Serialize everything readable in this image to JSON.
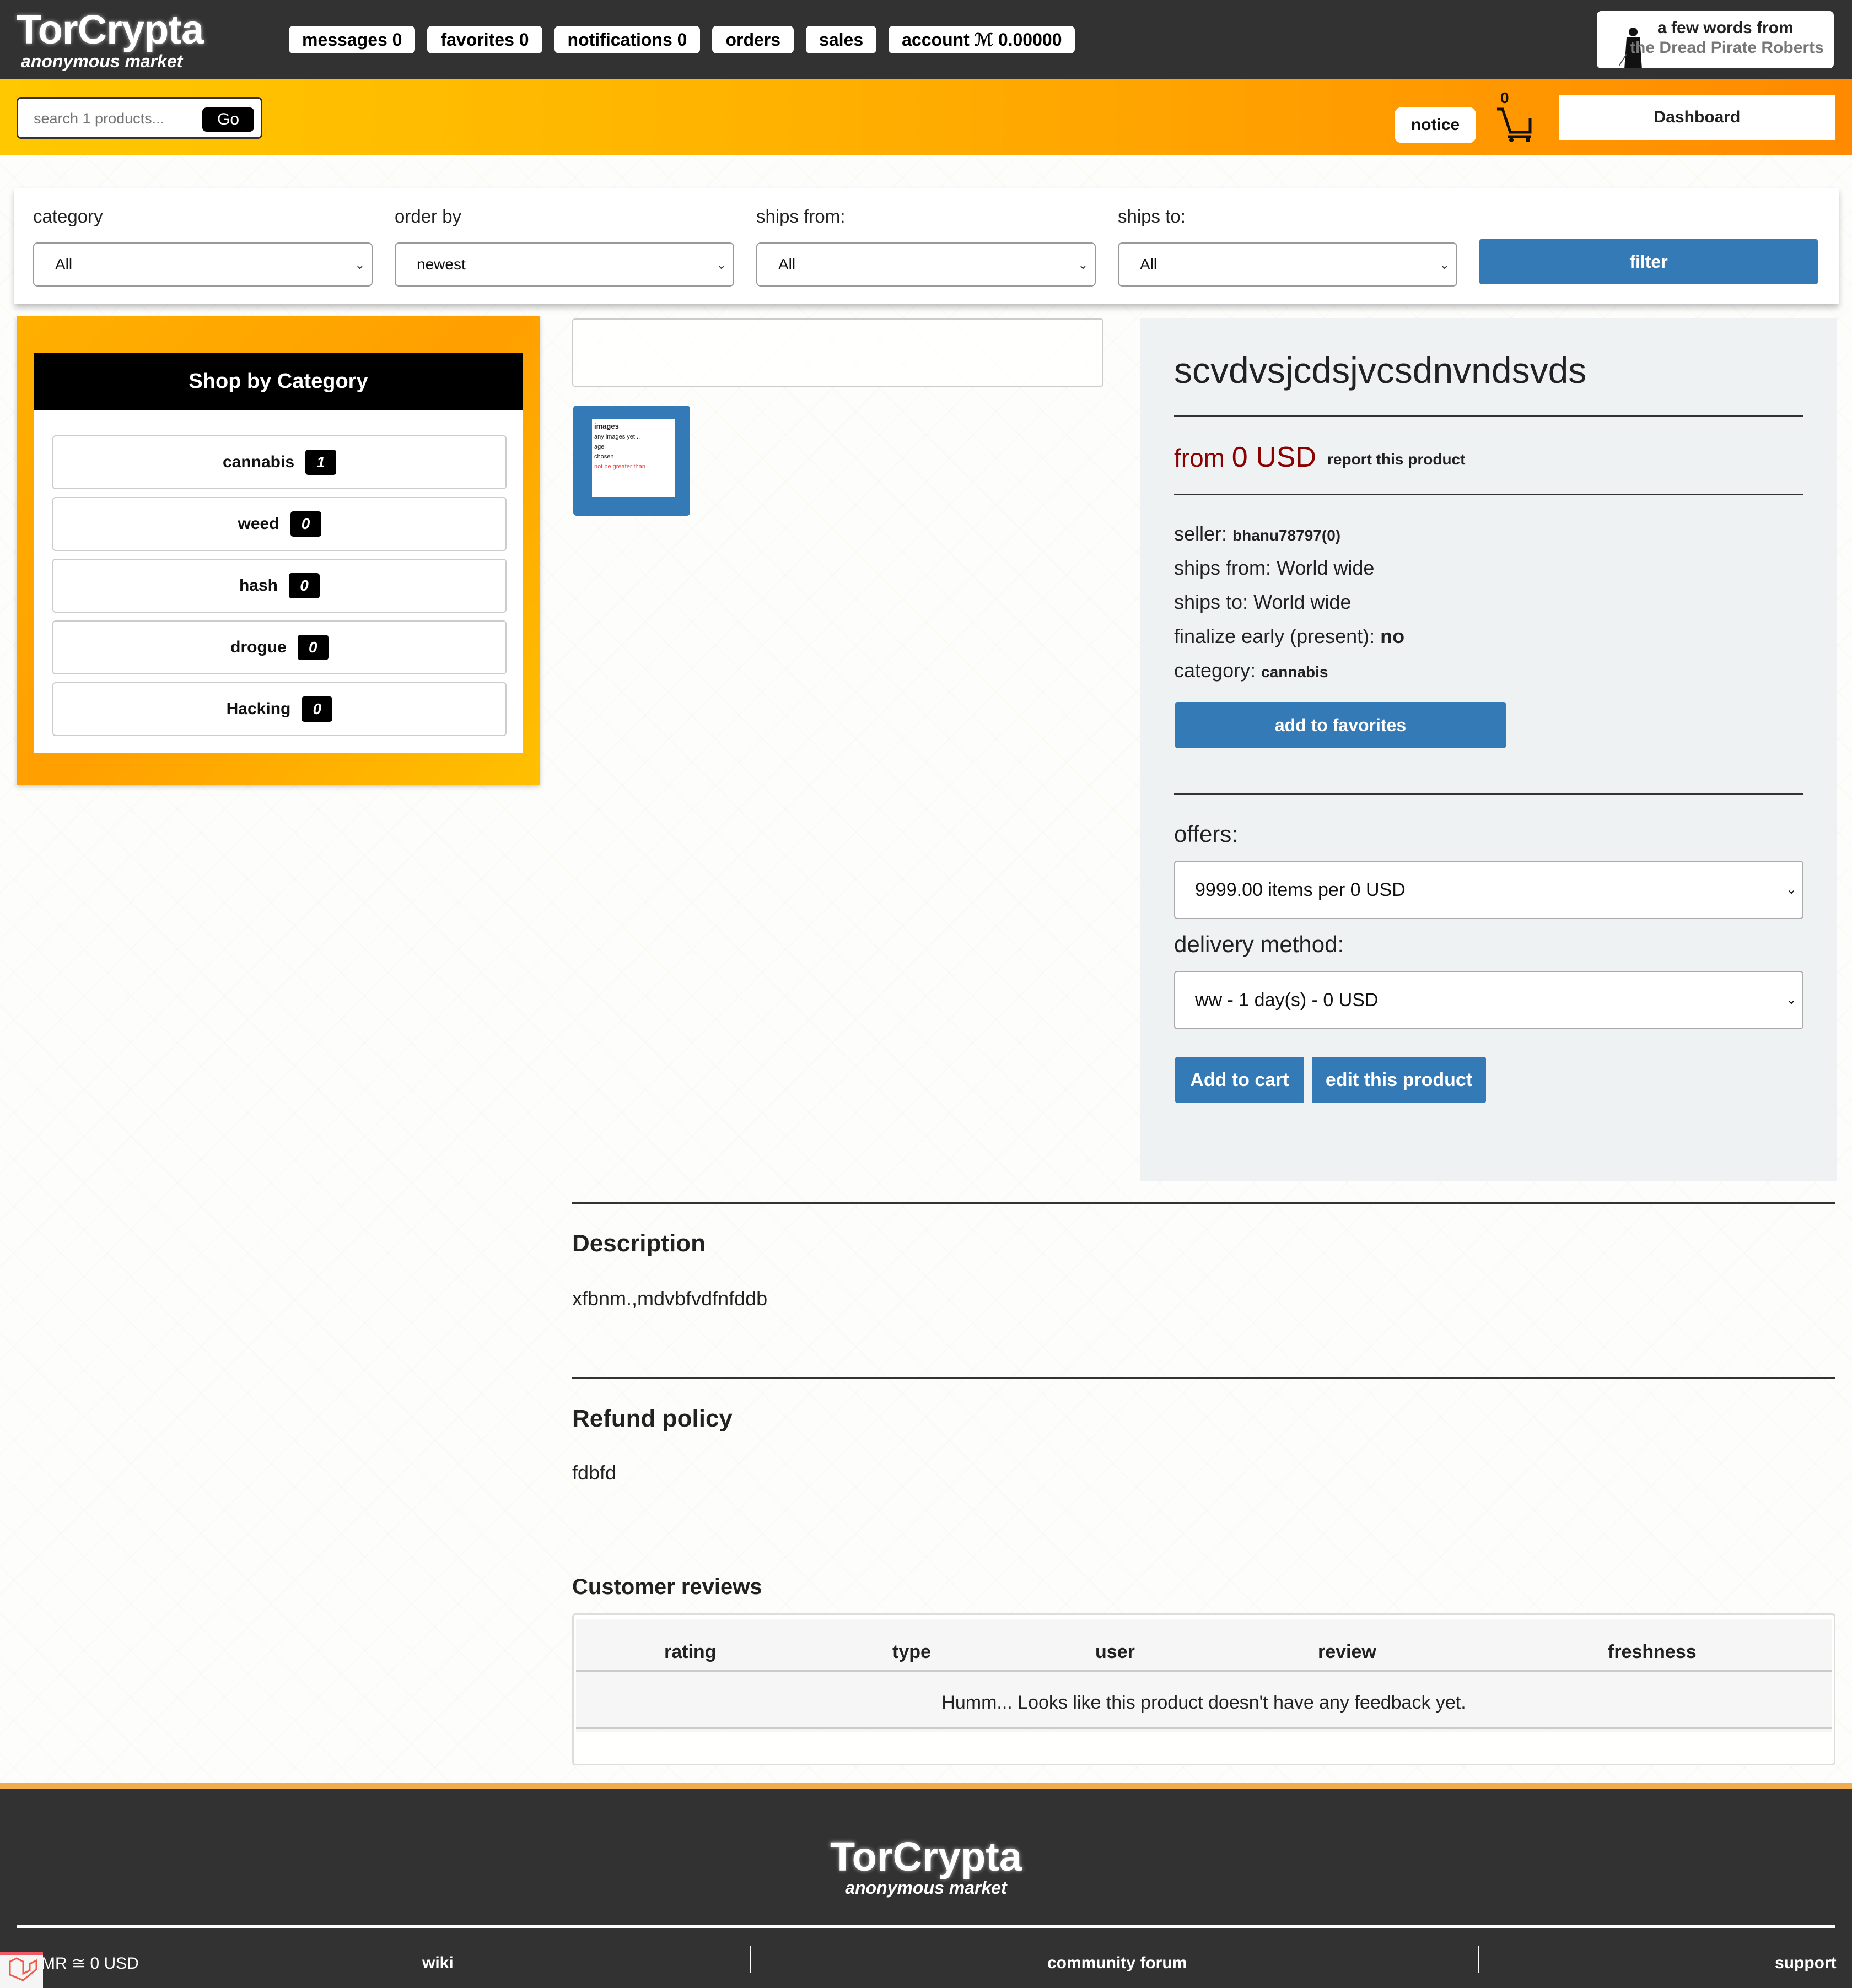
{
  "header": {
    "brand": "TorCrypta",
    "tagline": "anonymous market",
    "nav": [
      {
        "label": "messages 0"
      },
      {
        "label": "favorites 0"
      },
      {
        "label": "notifications 0"
      },
      {
        "label": "orders"
      },
      {
        "label": "sales"
      },
      {
        "label": "account ℳ 0.00000"
      }
    ],
    "dpr": {
      "line1": "a few words from",
      "line2": "the Dread Pirate Roberts"
    }
  },
  "subheader": {
    "search_placeholder": "search 1 products...",
    "go_label": "Go",
    "notice_label": "notice",
    "cart_count": "0",
    "dashboard_label": "Dashboard"
  },
  "filters": {
    "category": {
      "label": "category",
      "value": "All"
    },
    "order_by": {
      "label": "order by",
      "value": "newest"
    },
    "ships_from": {
      "label": "ships from:",
      "value": "All"
    },
    "ships_to": {
      "label": "ships to:",
      "value": "All"
    },
    "filter_label": "filter"
  },
  "categories": {
    "title": "Shop by Category",
    "items": [
      {
        "name": "cannabis",
        "count": "1"
      },
      {
        "name": "weed",
        "count": "0"
      },
      {
        "name": "hash",
        "count": "0"
      },
      {
        "name": "drogue",
        "count": "0"
      },
      {
        "name": "Hacking",
        "count": "0"
      }
    ]
  },
  "thumbnail": {
    "lines": [
      "images",
      "any images yet...",
      "age",
      "chosen",
      "not be greater than"
    ]
  },
  "product": {
    "title": "scvdvsjcdsjvcsdnvndsvds",
    "price_prefix": "from ",
    "price_amount": "0 USD",
    "report_label": "report this product",
    "seller_label": "seller: ",
    "seller_value": "bhanu78797(0)",
    "ships_from": "ships from: World wide",
    "ships_to": "ships to: World wide",
    "finalize_label": "finalize early (present): ",
    "finalize_value": "no",
    "category_label": "category: ",
    "category_value": "cannabis",
    "favorites_label": "add to favorites",
    "offers_label": "offers:",
    "offers_value": "9999.00 items per 0 USD",
    "delivery_label": "delivery method:",
    "delivery_value": "ww - 1 day(s) - 0 USD",
    "add_to_cart_label": "Add to cart",
    "edit_label": "edit this product"
  },
  "description": {
    "title": "Description",
    "text": "xfbnm.,mdvbfvdfnfddb"
  },
  "refund": {
    "title": "Refund policy",
    "text": "fdbfd"
  },
  "reviews": {
    "title": "Customer reviews",
    "columns": [
      "rating",
      "type",
      "user",
      "review",
      "freshness"
    ],
    "empty": "Humm... Looks like this product doesn't have any feedback yet."
  },
  "footer": {
    "brand": "TorCrypta",
    "tagline": "anonymous market",
    "rate": "1 XMR ≅ 0 USD",
    "links": [
      {
        "label": "wiki"
      },
      {
        "label": "community forum"
      },
      {
        "label": "support"
      }
    ]
  }
}
